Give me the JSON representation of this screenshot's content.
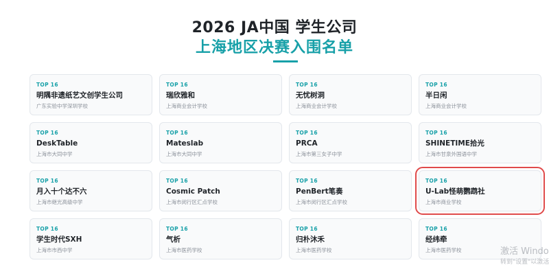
{
  "header": {
    "title_line1": "2026 JA中国 学生公司",
    "title_line2": "上海地区决赛入围名单",
    "accent_color": "#17a0a8",
    "highlight_color": "#e04a4a"
  },
  "cards": [
    {
      "badge": "TOP 16",
      "name": "明隅非遗纸艺文创学生公司",
      "school": "广东实验中学深圳学校",
      "highlighted": false
    },
    {
      "badge": "TOP 16",
      "name": "瑞欣雅和",
      "school": "上海商业会计学校",
      "highlighted": false
    },
    {
      "badge": "TOP 16",
      "name": "无忧树洞",
      "school": "上海商业会计学校",
      "highlighted": false
    },
    {
      "badge": "TOP 16",
      "name": "半日闲",
      "school": "上海商业会计学校",
      "highlighted": false
    },
    {
      "badge": "TOP 16",
      "name": "DeskTable",
      "school": "上海市大同中学",
      "highlighted": false
    },
    {
      "badge": "TOP 16",
      "name": "Mateslab",
      "school": "上海市大同中学",
      "highlighted": false
    },
    {
      "badge": "TOP 16",
      "name": "PRCA",
      "school": "上海市第三女子中学",
      "highlighted": false
    },
    {
      "badge": "TOP 16",
      "name": "SHINETIME拾光",
      "school": "上海市甘泉外国语中学",
      "highlighted": false
    },
    {
      "badge": "TOP 16",
      "name": "月入十个达不六",
      "school": "上海市继光高级中学",
      "highlighted": false
    },
    {
      "badge": "TOP 16",
      "name": "Cosmic Patch",
      "school": "上海市闵行区汇点学校",
      "highlighted": false
    },
    {
      "badge": "TOP 16",
      "name": "PenBert笔奏",
      "school": "上海市闵行区汇点学校",
      "highlighted": false
    },
    {
      "badge": "TOP 16",
      "name": "U-Lab怪萌鹦鹉社",
      "school": "上海市商业学校",
      "highlighted": true
    },
    {
      "badge": "TOP 16",
      "name": "学生时代SXH",
      "school": "上海市市西中学",
      "highlighted": false
    },
    {
      "badge": "TOP 16",
      "name": "气析",
      "school": "上海市医药学校",
      "highlighted": false
    },
    {
      "badge": "TOP 16",
      "name": "归朴沐禾",
      "school": "上海市医药学校",
      "highlighted": false
    },
    {
      "badge": "TOP 16",
      "name": "经纬牵",
      "school": "上海市医药学校",
      "highlighted": false
    }
  ],
  "watermark": {
    "line1": "激活 Windows",
    "line2": "转到\"设置\"以激活 Windows。"
  }
}
